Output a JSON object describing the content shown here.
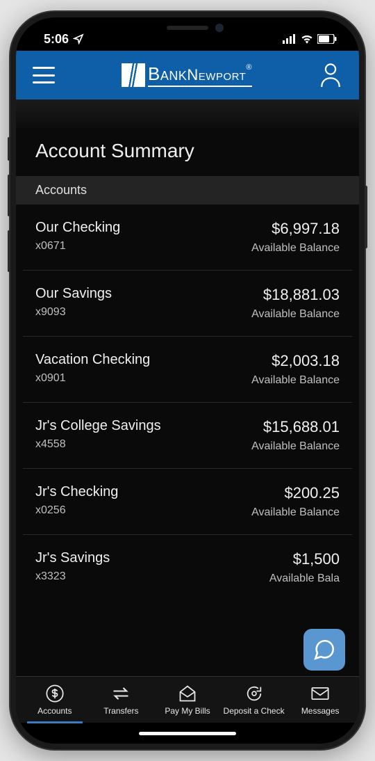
{
  "status": {
    "time": "5:06"
  },
  "header": {
    "brand_first": "Bank",
    "brand_second": "Newport"
  },
  "page": {
    "title": "Account Summary",
    "section_label": "Accounts"
  },
  "accounts": [
    {
      "name": "Our Checking",
      "number": "x0671",
      "balance": "$6,997.18",
      "balance_label": "Available Balance"
    },
    {
      "name": "Our Savings",
      "number": "x9093",
      "balance": "$18,881.03",
      "balance_label": "Available Balance"
    },
    {
      "name": "Vacation Checking",
      "number": "x0901",
      "balance": "$2,003.18",
      "balance_label": "Available Balance"
    },
    {
      "name": "Jr's College Savings",
      "number": "x4558",
      "balance": "$15,688.01",
      "balance_label": "Available Balance"
    },
    {
      "name": "Jr's Checking",
      "number": "x0256",
      "balance": "$200.25",
      "balance_label": "Available Balance"
    },
    {
      "name": "Jr's Savings",
      "number": "x3323",
      "balance": "$1,500",
      "balance_label": "Available Bala"
    }
  ],
  "tabs": [
    {
      "label": "Accounts"
    },
    {
      "label": "Transfers"
    },
    {
      "label": "Pay My Bills"
    },
    {
      "label": "Deposit a Check"
    },
    {
      "label": "Messages"
    }
  ]
}
